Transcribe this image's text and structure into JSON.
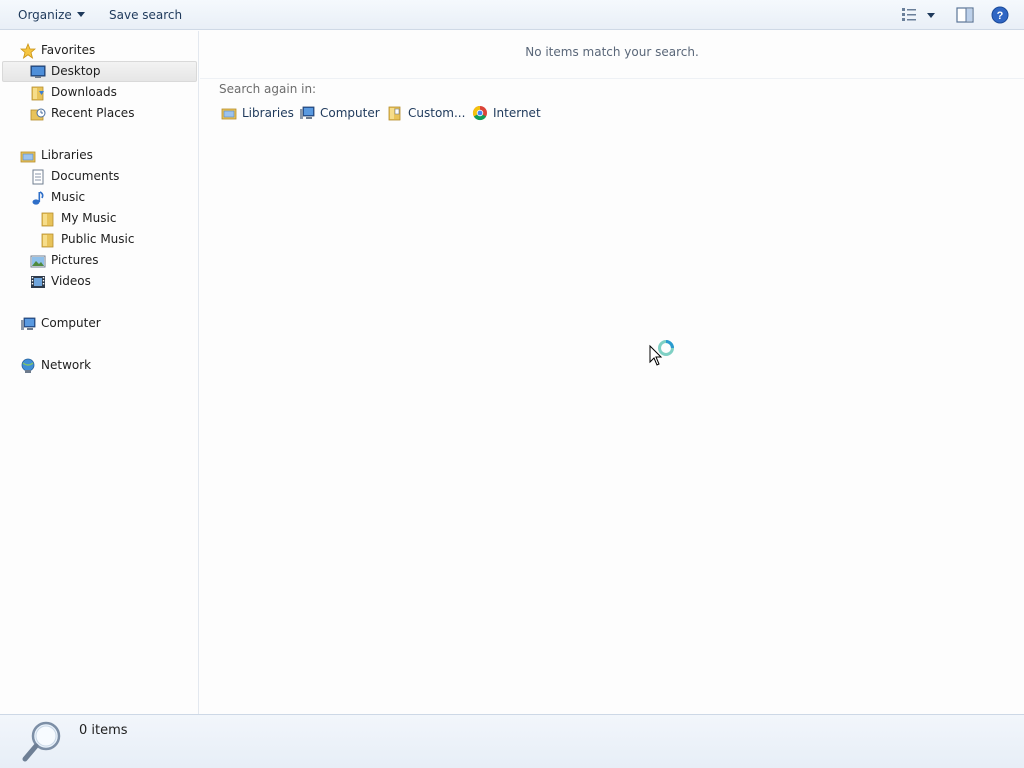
{
  "toolbar": {
    "organize_label": "Organize",
    "save_search_label": "Save search",
    "icons": [
      "change-view-icon",
      "view-options-caret-icon",
      "preview-pane-icon",
      "help-icon"
    ]
  },
  "sidebar": {
    "favorites": {
      "label": "Favorites",
      "items": [
        {
          "label": "Desktop",
          "icon": "desktop-icon",
          "selected": true
        },
        {
          "label": "Downloads",
          "icon": "downloads-folder-icon"
        },
        {
          "label": "Recent Places",
          "icon": "recent-places-icon"
        }
      ]
    },
    "libraries": {
      "label": "Libraries",
      "items": [
        {
          "label": "Documents",
          "icon": "documents-icon"
        },
        {
          "label": "Music",
          "icon": "music-icon"
        },
        {
          "label": "My Music",
          "icon": "folder-icon"
        },
        {
          "label": "Public Music",
          "icon": "folder-icon"
        },
        {
          "label": "Pictures",
          "icon": "pictures-icon"
        },
        {
          "label": "Videos",
          "icon": "videos-icon"
        }
      ]
    },
    "computer": {
      "label": "Computer"
    },
    "network": {
      "label": "Network"
    }
  },
  "content": {
    "message": "No items match your search.",
    "search_again_label": "Search again in:",
    "search_locations": [
      {
        "label": "Libraries",
        "icon": "libraries-icon"
      },
      {
        "label": "Computer",
        "icon": "computer-icon"
      },
      {
        "label": "Custom...",
        "icon": "custom-folder-icon"
      },
      {
        "label": "Internet",
        "icon": "browser-icon"
      }
    ]
  },
  "status": {
    "count_text": "0 items"
  },
  "colors": {
    "toolbar_bg": "#e9eff7",
    "text": "#1e395b",
    "selection": "#e6e6e6",
    "statusbar_bg": "#e7eef7"
  }
}
